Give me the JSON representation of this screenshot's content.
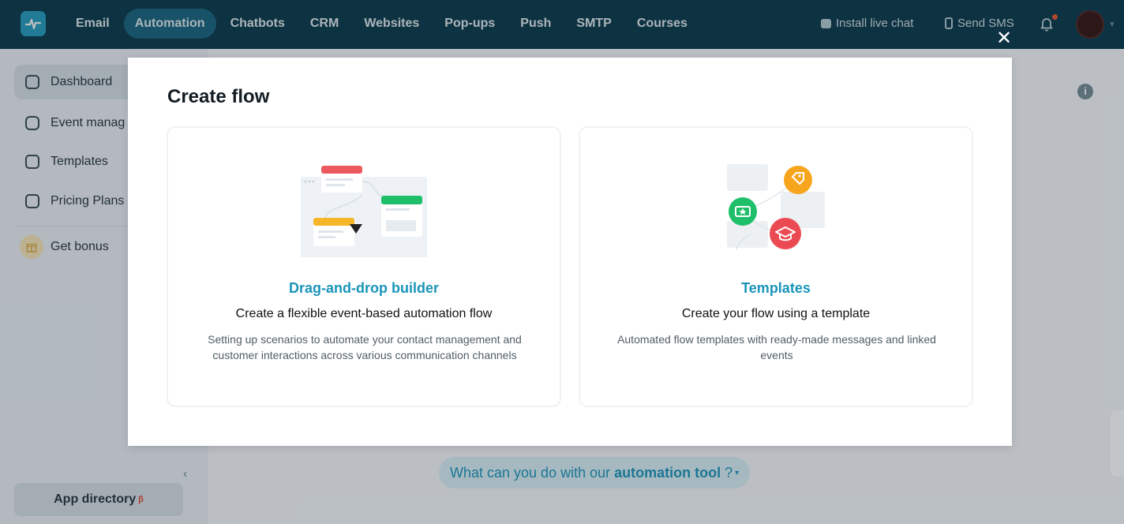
{
  "nav": {
    "items": [
      "Email",
      "Automation",
      "Chatbots",
      "CRM",
      "Websites",
      "Pop-ups",
      "Push",
      "SMTP",
      "Courses"
    ],
    "active": "Automation",
    "install_chat": "Install live chat",
    "send_sms": "Send SMS"
  },
  "sidebar": {
    "items": [
      {
        "label": "Dashboard",
        "icon": "dashboard-icon"
      },
      {
        "label": "Event manag",
        "icon": "event-icon"
      },
      {
        "label": "Templates",
        "icon": "templates-icon"
      },
      {
        "label": "Pricing Plans",
        "icon": "pricing-icon"
      }
    ],
    "bonus": "Get bonus",
    "app_directory": "App directory",
    "app_directory_badge": "β"
  },
  "main": {
    "question_prefix": "What can you do with our",
    "question_bold": "automation tool",
    "question_suffix": "?"
  },
  "modal": {
    "title": "Create flow",
    "cards": [
      {
        "title": "Drag-and-drop builder",
        "subtitle": "Create a flexible event-based automation flow",
        "description": "Setting up scenarios to automate your contact management and customer interactions across various communication channels"
      },
      {
        "title": "Templates",
        "subtitle": "Create your flow using a template",
        "description": "Automated flow templates with ready-made messages and linked events"
      }
    ]
  },
  "colors": {
    "nav_bg": "#0f3e52",
    "accent": "#1a95ba",
    "active_nav": "#1e6a87"
  }
}
